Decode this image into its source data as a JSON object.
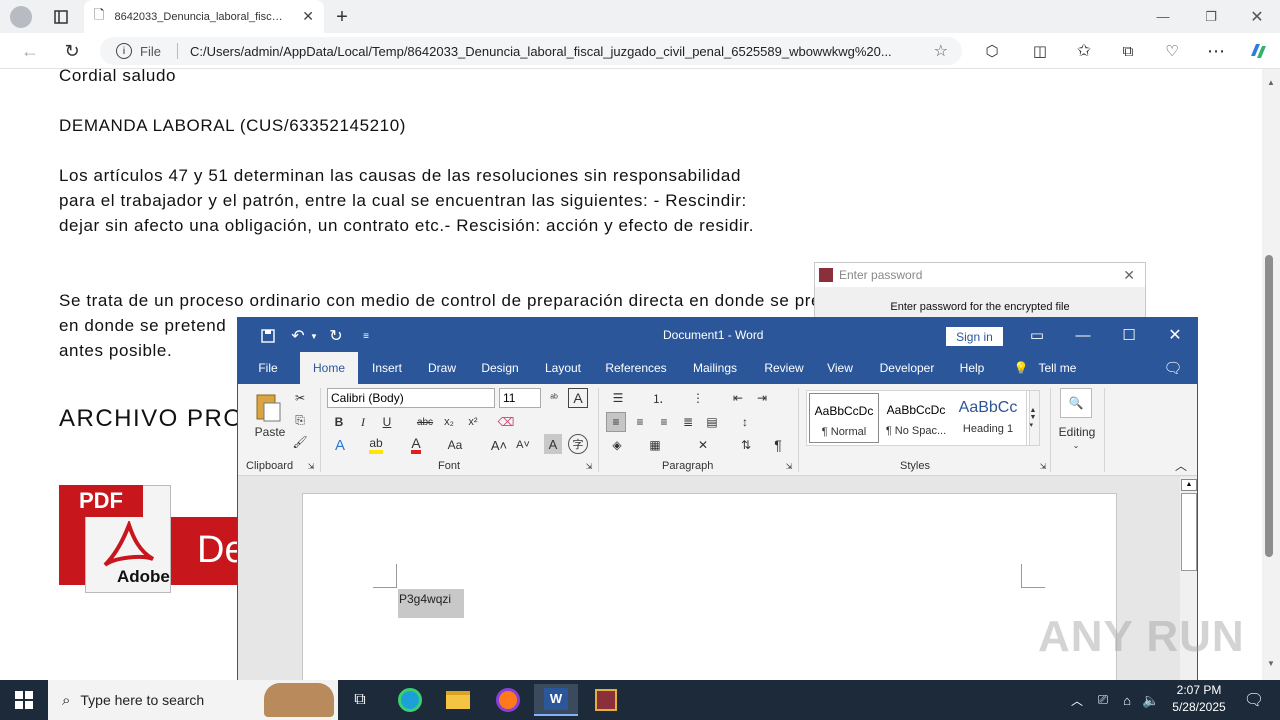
{
  "browser": {
    "tab_title": "8642033_Denuncia_laboral_fiscal_",
    "address_prefix": "File",
    "address_url": "C:/Users/admin/AppData/Local/Temp/8642033_Denuncia_laboral_fiscal_juzgado_civil_penal_6525589_wbowwkwg%20..."
  },
  "page": {
    "greeting": "Cordial saludo",
    "heading": "DEMANDA LABORAL (CUS/63352145210)",
    "para1": "Los artículos 47 y 51 determinan las causas de las resoluciones sin responsabilidad para el trabajador y el patrón, entre la cual se encuentran las siguientes: - Rescindir: dejar sin afecto una obligación, un contrato etc.- Rescisión: acción y efecto de residir.",
    "para2": "Se trata de un proceso ordinario con medio de control de preparación directa en donde se pretend",
    "para2_end": "antes posible.",
    "big_heading": "ARCHIVO PRO",
    "pdf_label": "PDF",
    "adobe_label": "Adobe",
    "banner_text": "De"
  },
  "password_dialog": {
    "title": "Enter password",
    "message": "Enter password for the encrypted file"
  },
  "word": {
    "doc_title": "Document1  -  Word",
    "sign_in": "Sign in",
    "tabs": [
      "File",
      "Home",
      "Insert",
      "Draw",
      "Design",
      "Layout",
      "References",
      "Mailings",
      "Review",
      "View",
      "Developer",
      "Help",
      "Tell me"
    ],
    "font_name": "Calibri (Body)",
    "font_size": "11",
    "paste": "Paste",
    "groups": {
      "clipboard": "Clipboard",
      "font": "Font",
      "paragraph": "Paragraph",
      "styles": "Styles"
    },
    "styles": [
      {
        "preview": "AaBbCcDc",
        "name": "¶ Normal"
      },
      {
        "preview": "AaBbCcDc",
        "name": "¶ No Spac..."
      },
      {
        "preview": "AaBbCc",
        "name": "Heading 1"
      }
    ],
    "editing": "Editing",
    "doc_text": "P3g4wqzi"
  },
  "watermark": "ANY RUN",
  "taskbar": {
    "search_placeholder": "Type here to search",
    "time": "2:07 PM",
    "date": "5/28/2025"
  },
  "colors": {
    "word_blue": "#2b579a",
    "taskbar": "#1c2a3a",
    "pdf_red": "#c8161d"
  }
}
